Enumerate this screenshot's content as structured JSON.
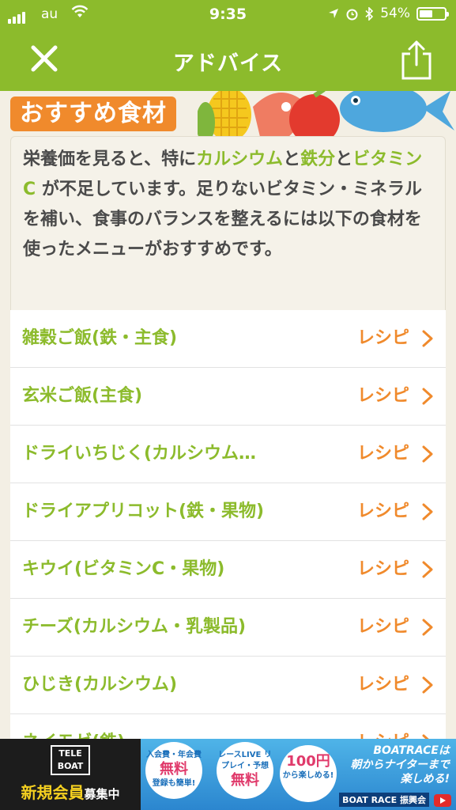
{
  "status_bar": {
    "carrier": "au",
    "time": "9:35",
    "battery_percent": "54%",
    "battery_level": 0.54
  },
  "nav": {
    "title": "アドバイス"
  },
  "banner": {
    "heading": "おすすめ食材"
  },
  "intro": {
    "segments": [
      {
        "text": "栄養価を見ると、特に",
        "hl": false
      },
      {
        "text": "カルシウム",
        "hl": true
      },
      {
        "text": "と",
        "hl": false
      },
      {
        "text": "鉄分",
        "hl": true
      },
      {
        "text": "と",
        "hl": false
      },
      {
        "text": "ビタミンC",
        "hl": true
      },
      {
        "text": " が不足しています。足りないビタミン・ミネラルを補い、食事のバランスを整えるには以下の食材を使ったメニューがおすすめです。",
        "hl": false
      }
    ]
  },
  "foods": [
    {
      "name": "雑穀ご飯(鉄・主食)",
      "recipe_label": "レシピ"
    },
    {
      "name": "玄米ご飯(主食)",
      "recipe_label": "レシピ"
    },
    {
      "name": "ドライいちじく(カルシウム…",
      "recipe_label": "レシピ"
    },
    {
      "name": "ドライアプリコット(鉄・果物)",
      "recipe_label": "レシピ"
    },
    {
      "name": "キウイ(ビタミンC・果物)",
      "recipe_label": "レシピ"
    },
    {
      "name": "チーズ(カルシウム・乳製品)",
      "recipe_label": "レシピ"
    },
    {
      "name": "ひじき(カルシウム)",
      "recipe_label": "レシピ"
    },
    {
      "name": "ネイモゼ(鉄)",
      "recipe_label": "レシピ"
    }
  ],
  "ad": {
    "teleboat_logo_line1": "TELE",
    "teleboat_logo_line2": "BOAT",
    "cta_main": "新規会員",
    "cta_sub": "募集中",
    "bubble1_top": "入会費・年会費",
    "bubble1_main": "無料",
    "bubble1_bottom": "登録も簡単!",
    "bubble2_top": "レースLIVE リプレイ・予想",
    "bubble2_main": "無料",
    "bubble3_main": "100円",
    "bubble3_bottom": "から楽しめる!",
    "slogan_line1": "BOATRACEは",
    "slogan_line2": "朝からナイターまで",
    "slogan_line3": "楽しめる!",
    "org": "BOAT RACE 振興会"
  },
  "colors": {
    "brand_green": "#8cbb2c",
    "accent_orange": "#f08a2c",
    "text": "#4a4a4a"
  }
}
